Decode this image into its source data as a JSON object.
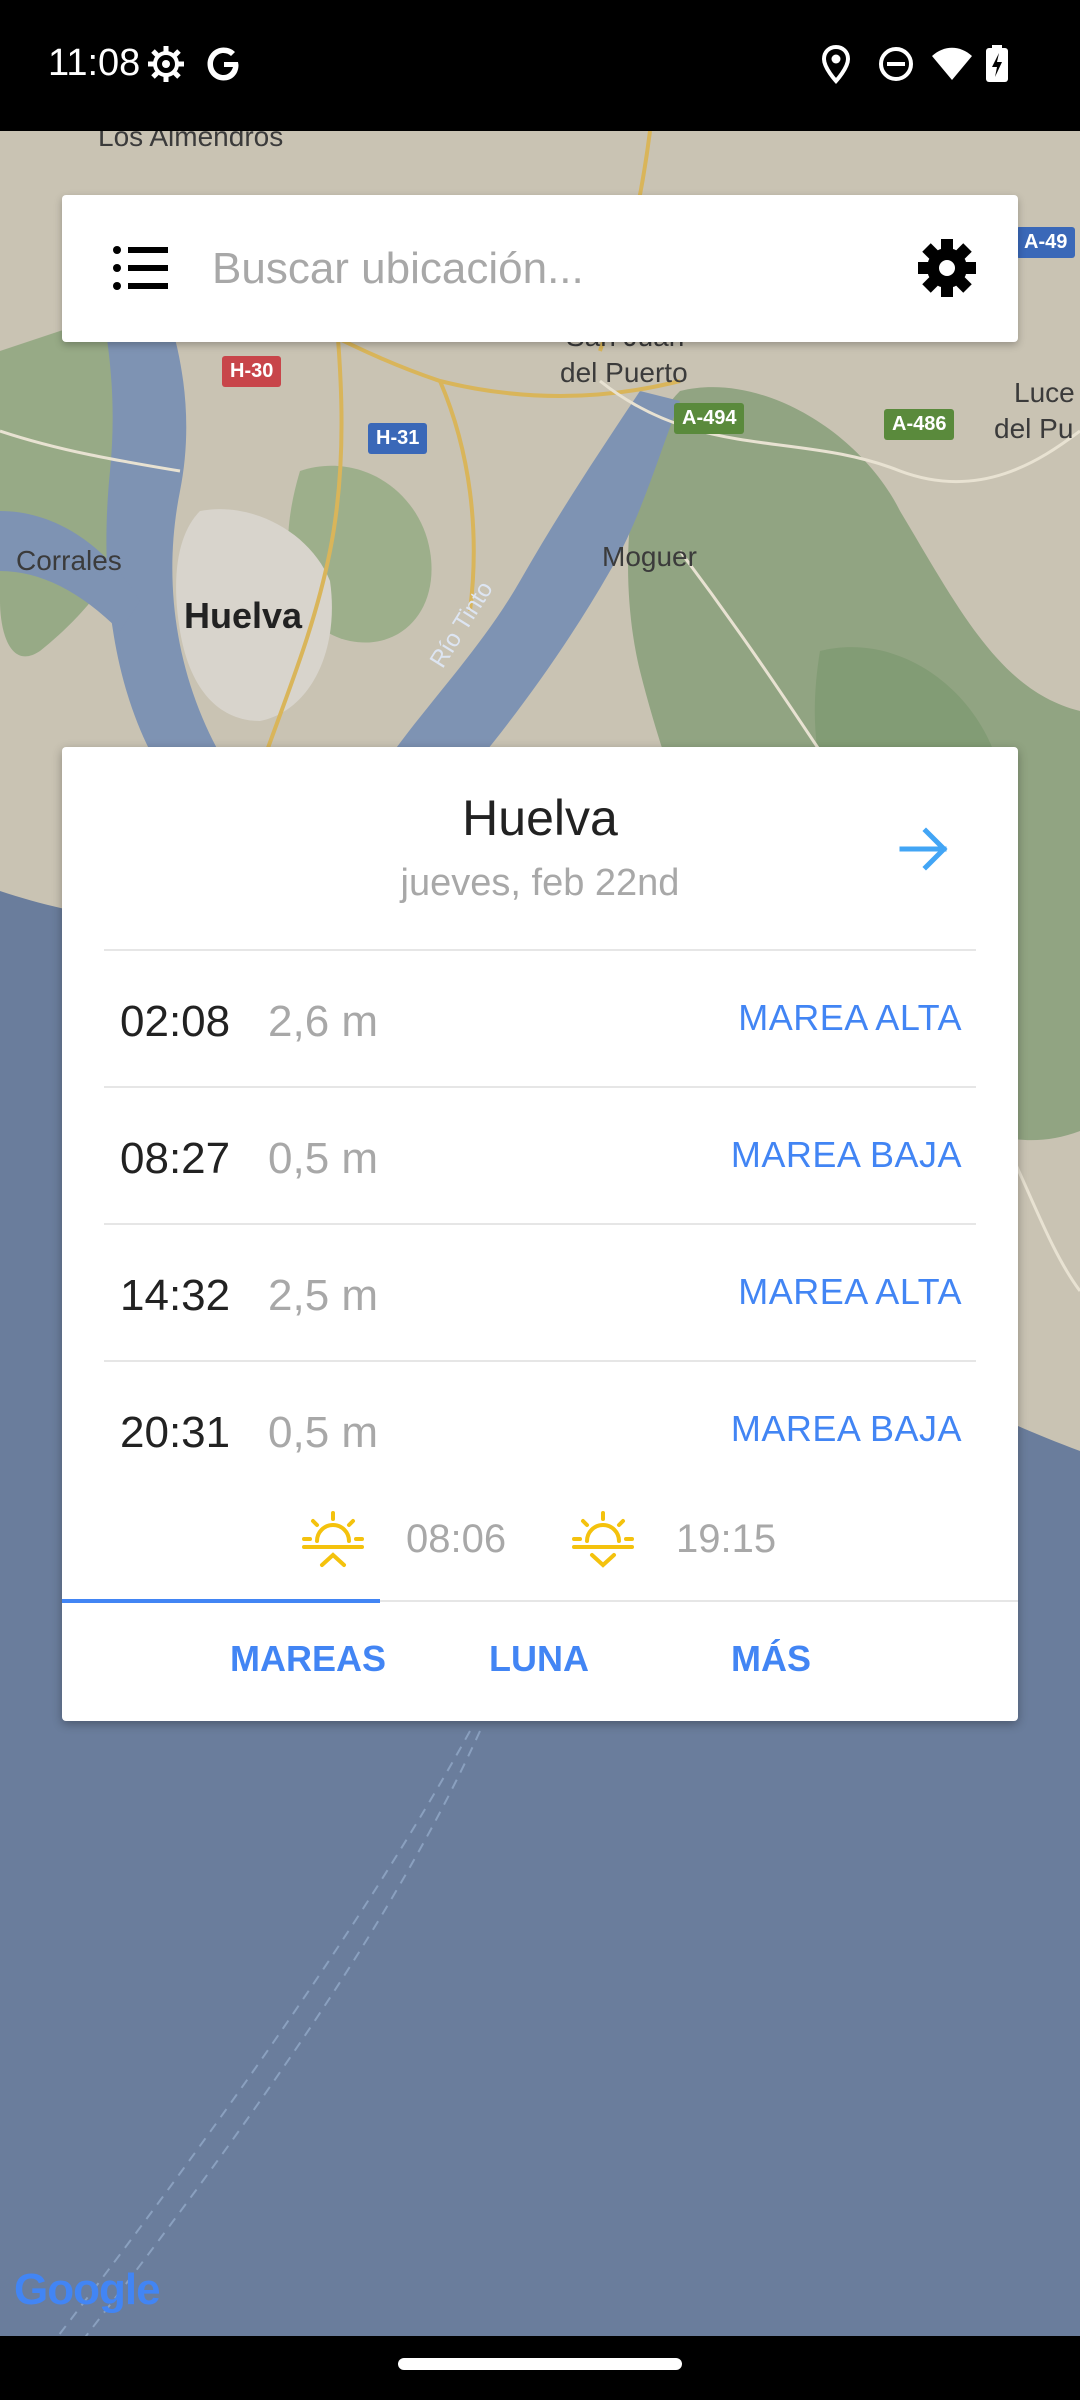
{
  "status_bar": {
    "time": "11:08",
    "icons": [
      "settings-gear-icon",
      "google-g-icon",
      "location-pin-icon",
      "do-not-disturb-icon",
      "wifi-icon",
      "battery-charging-icon"
    ]
  },
  "map": {
    "labels": {
      "los_almendros": "Los Almendros",
      "san_juan_1": "San Juan",
      "san_juan_2": "del Puerto",
      "lucena_1": "Luce",
      "lucena_2": "del Pu",
      "corrales": "Corrales",
      "huelva": "Huelva",
      "moguer": "Moguer",
      "rio_tinto": "Río Tinto"
    },
    "shields": {
      "h30": "H-30",
      "h31": "H-31",
      "a494": "A-494",
      "a486": "A-486",
      "a49": "A-49"
    },
    "google": "Google"
  },
  "search": {
    "placeholder": "Buscar ubicación...",
    "value": ""
  },
  "card": {
    "city": "Huelva",
    "date": "jueves, feb 22nd",
    "tides": [
      {
        "time": "02:08",
        "height": "2,6 m",
        "type": "MAREA ALTA"
      },
      {
        "time": "08:27",
        "height": "0,5 m",
        "type": "MAREA BAJA"
      },
      {
        "time": "14:32",
        "height": "2,5 m",
        "type": "MAREA ALTA"
      },
      {
        "time": "20:31",
        "height": "0,5 m",
        "type": "MAREA BAJA"
      }
    ],
    "sunrise": "08:06",
    "sunset": "19:15",
    "tabs": [
      "MAREAS",
      "LUNA",
      "MÁS"
    ],
    "active_tab": "MAREAS"
  },
  "colors": {
    "accent": "#4285f4",
    "sun": "#f4c20d",
    "sea": "#6a7d9c",
    "land": "#c9c3b3"
  }
}
